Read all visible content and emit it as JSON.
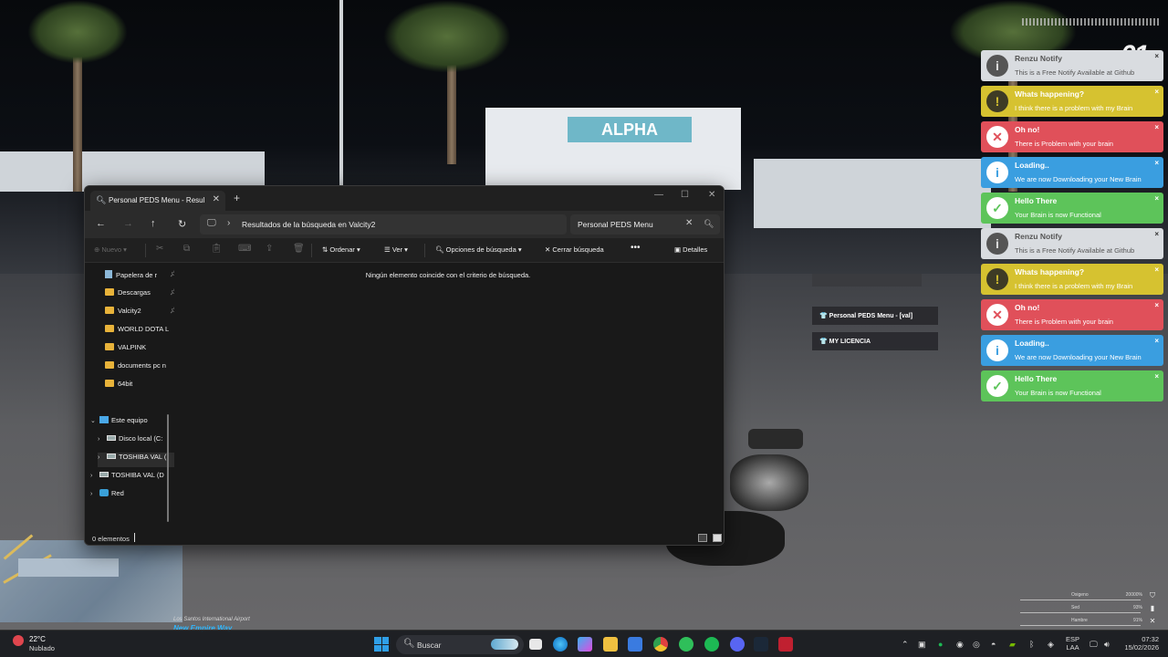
{
  "window": {
    "tab_title": "Personal PEDS Menu - Resulta",
    "address_path": "Resultados de la búsqueda en Valcity2",
    "search_value": "Personal PEDS Menu",
    "empty_message": "Ningún elemento coincide con el criterio de búsqueda.",
    "status_count": "0 elementos"
  },
  "commandbar": {
    "new_label": "Nuevo",
    "sort_label": "Ordenar",
    "view_label": "Ver",
    "search_options_label": "Opciones de búsqueda",
    "close_search_label": "Cerrar búsqueda",
    "details_label": "Detalles"
  },
  "sidebar": {
    "items": [
      {
        "label": "Papelera de r",
        "pinned": true
      },
      {
        "label": "Descargas",
        "pinned": true
      },
      {
        "label": "Valcity2",
        "pinned": true
      },
      {
        "label": "WORLD DOTA L",
        "pinned": false
      },
      {
        "label": "VALPINK",
        "pinned": false
      },
      {
        "label": "documents pc n",
        "pinned": false
      },
      {
        "label": "64bit",
        "pinned": false
      }
    ],
    "this_pc": "Este equipo",
    "drives": [
      "Disco local (C:",
      "TOSHIBA VAL (",
      "TOSHIBA VAL (D"
    ],
    "network": "Red"
  },
  "notifications": [
    {
      "type": "gray",
      "title": "Renzu Notify",
      "message": "This is a Free Notify Available at Github",
      "icon": "info-icon"
    },
    {
      "type": "yellow",
      "title": "Whats happening?",
      "message": "I think there is a problem with my Brain",
      "icon": "warning-icon"
    },
    {
      "type": "red",
      "title": "Oh no!",
      "message": "There is Problem with your brain",
      "icon": "error-icon"
    },
    {
      "type": "blue",
      "title": "Loading..",
      "message": "We are now Downloading your New Brain",
      "icon": "info-icon"
    },
    {
      "type": "green",
      "title": "Hello There",
      "message": "Your Brain is now Functional",
      "icon": "check-icon"
    },
    {
      "type": "gray",
      "title": "Renzu Notify",
      "message": "This is a Free Notify Available at Github",
      "icon": "info-icon"
    },
    {
      "type": "yellow",
      "title": "Whats happening?",
      "message": "I think there is a problem with my Brain",
      "icon": "warning-icon"
    },
    {
      "type": "red",
      "title": "Oh no!",
      "message": "There is Problem with your brain",
      "icon": "error-icon"
    },
    {
      "type": "blue",
      "title": "Loading..",
      "message": "We are now Downloading your New Brain",
      "icon": "info-icon"
    },
    {
      "type": "green",
      "title": "Hello There",
      "message": "Your Brain is now Functional",
      "icon": "check-icon"
    }
  ],
  "game_menu": {
    "items": [
      "Personal PEDS Menu - [val]",
      "MY LICENCIA"
    ]
  },
  "game_hud": {
    "logo": "01",
    "street_small": "Los Santos International Airport",
    "street_big": "New Empire Way",
    "stats": [
      {
        "label": "Oxigeno",
        "value": "20000%"
      },
      {
        "label": "Sed",
        "value": "93%"
      },
      {
        "label": "Hambre",
        "value": "91%"
      }
    ]
  },
  "taskbar": {
    "temperature": "22°C",
    "condition": "Nublado",
    "search_label": "Buscar",
    "lang_top": "ESP",
    "lang_bottom": "LAA",
    "time": "07:32",
    "date": "15/02/2026"
  },
  "colors": {
    "notif_gray": "#d9dce0",
    "notif_yellow": "#d6c230",
    "notif_red": "#e0505a",
    "notif_blue": "#3a9ee0",
    "notif_green": "#5dc45a",
    "folder": "#e8b33a",
    "win_bg": "#191919"
  }
}
